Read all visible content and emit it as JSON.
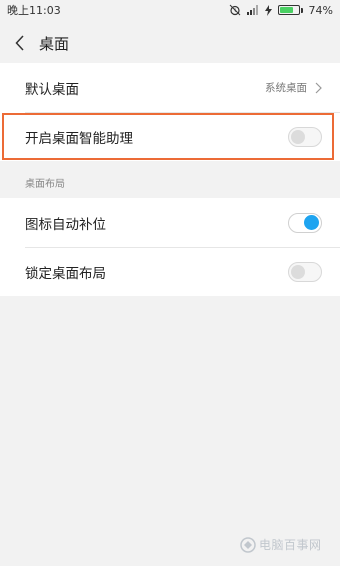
{
  "status_bar": {
    "time": "晚上11:03",
    "battery_percent_text": "74%",
    "battery_level": 0.74,
    "icons": [
      "alarm-icon",
      "signal-icon",
      "charging-icon",
      "battery-icon"
    ]
  },
  "header": {
    "title": "桌面",
    "back_icon": "chevron-left-icon"
  },
  "default_desktop": {
    "label": "默认桌面",
    "value": "系统桌面"
  },
  "smart_assistant": {
    "label": "开启桌面智能助理",
    "enabled": false
  },
  "layout_section": {
    "title": "桌面布局",
    "items": [
      {
        "label": "图标自动补位",
        "enabled": true
      },
      {
        "label": "锁定桌面布局",
        "enabled": false
      }
    ]
  },
  "colors": {
    "accent": "#1ea4f0",
    "highlight": "#ec6b36",
    "background": "#f2f2f2"
  },
  "watermark": {
    "text": "电脑百事网"
  }
}
